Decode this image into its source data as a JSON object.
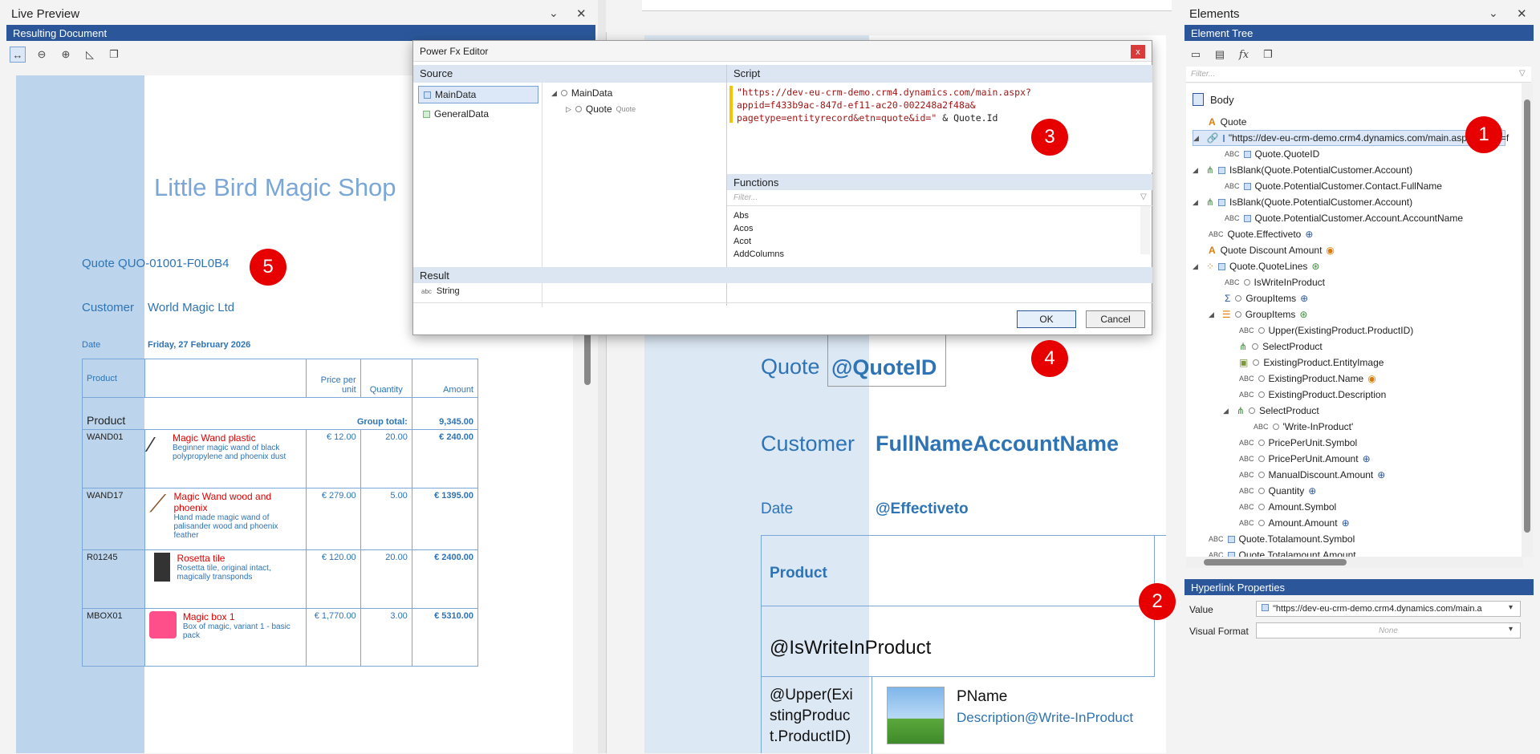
{
  "live_preview": {
    "title": "Live Preview",
    "subtitle": "Resulting Document",
    "doc": {
      "shop_name": "Little Bird Magic Shop",
      "quote_label": "Quote QUO-01001-F0L0B4",
      "customer_label": "Customer",
      "customer_value": "World Magic Ltd",
      "date_label": "Date",
      "date_value": "Friday, 27 February 2026",
      "table": {
        "headers": [
          "Product",
          "Price per unit",
          "Quantity",
          "Amount"
        ],
        "group_label": "Product",
        "group_total_label": "Group total:",
        "group_total_value": "9,345.00",
        "rows": [
          {
            "code": "WAND01",
            "name": "Magic Wand plastic",
            "desc": "Beginner magic wand of black polypropylene and phoenix dust",
            "price": "€ 12.00",
            "qty": "20.00",
            "amount": "€ 240.00"
          },
          {
            "code": "WAND17",
            "name": "Magic Wand wood and phoenix",
            "desc": "Hand made magic wand of palisander wood and phoenix feather",
            "price": "€ 279.00",
            "qty": "5.00",
            "amount": "€ 1395.00"
          },
          {
            "code": "R01245",
            "name": "Rosetta tile",
            "desc": "Rosetta tile, original intact, magically transponds",
            "price": "€ 120.00",
            "qty": "20.00",
            "amount": "€ 2400.00"
          },
          {
            "code": "MBOX01",
            "name": "Magic box 1",
            "desc": "Box of magic, variant 1 - basic pack",
            "price": "€ 1,770.00",
            "qty": "3.00",
            "amount": "€ 5310.00"
          }
        ]
      }
    }
  },
  "designer": {
    "quote_label": "Quote",
    "quote_field": "@QuoteID",
    "customer_label": "Customer",
    "customer_field": "FullNameAccountName",
    "date_label": "Date",
    "date_field": "@Effectiveto",
    "product_header": "Product",
    "writein_field": "@IsWriteInProduct",
    "upper_field": "@Upper(ExistingProduct.ProductID)",
    "pname": "PName",
    "desc_field": "Description@Write-InProduct"
  },
  "dialog": {
    "title": "Power Fx Editor",
    "source_label": "Source",
    "sources": [
      "MainData",
      "GeneralData"
    ],
    "tree_root": "MainData",
    "tree_child": "Quote",
    "tree_child_type": "Quote",
    "script_label": "Script",
    "script_line1": "\"https://dev-eu-crm-demo.crm4.dynamics.com/main.aspx?",
    "script_line2": "appid=f433b9ac-847d-ef11-ac20-002248a2f48a&",
    "script_line3": "pagetype=entityrecord&etn=quote&id=\"",
    "script_op": "&",
    "script_ref": "Quote.Id",
    "functions_label": "Functions",
    "functions_filter": "Filter...",
    "functions": [
      "Abs",
      "Acos",
      "Acot",
      "AddColumns"
    ],
    "result_label": "Result",
    "result_type_icon": "abc",
    "result_value": "String",
    "ok": "OK",
    "cancel": "Cancel",
    "close": "x"
  },
  "elements": {
    "title": "Elements",
    "subtitle": "Element Tree",
    "filter": "Filter...",
    "tree": [
      {
        "label": "Body",
        "level": 0
      },
      {
        "label": "Quote",
        "level": 1
      },
      {
        "label": "\"https://dev-eu-crm-demo.crm4.dynamics.com/main.aspx?appid=f",
        "level": 1
      },
      {
        "label": "Quote.QuoteID",
        "level": 2
      },
      {
        "label": "IsBlank(Quote.PotentialCustomer.Account)",
        "level": 1
      },
      {
        "label": "Quote.PotentialCustomer.Contact.FullName",
        "level": 2
      },
      {
        "label": "IsBlank(Quote.PotentialCustomer.Account)",
        "level": 1
      },
      {
        "label": "Quote.PotentialCustomer.Account.AccountName",
        "level": 2
      },
      {
        "label": "Quote.Effectiveto",
        "level": 1
      },
      {
        "label": "Quote Discount Amount",
        "level": 1
      },
      {
        "label": "Quote.QuoteLines",
        "level": 1
      },
      {
        "label": "IsWriteInProduct",
        "level": 2
      },
      {
        "label": "GroupItems",
        "level": 2
      },
      {
        "label": "GroupItems",
        "level": 2
      },
      {
        "label": "Upper(ExistingProduct.ProductID)",
        "level": 3
      },
      {
        "label": "SelectProduct",
        "level": 3
      },
      {
        "label": "ExistingProduct.EntityImage",
        "level": 3
      },
      {
        "label": "ExistingProduct.Name",
        "level": 3
      },
      {
        "label": "ExistingProduct.Description",
        "level": 3
      },
      {
        "label": "SelectProduct",
        "level": 3
      },
      {
        "label": "'Write-InProduct'",
        "level": 4
      },
      {
        "label": "PricePerUnit.Symbol",
        "level": 3
      },
      {
        "label": "PricePerUnit.Amount",
        "level": 3
      },
      {
        "label": "ManualDiscount.Amount",
        "level": 3
      },
      {
        "label": "Quantity",
        "level": 3
      },
      {
        "label": "Amount.Symbol",
        "level": 3
      },
      {
        "label": "Amount.Amount",
        "level": 3
      },
      {
        "label": "Quote.Totalamount.Symbol",
        "level": 1
      },
      {
        "label": "Quote.Totalamount.Amount",
        "level": 1
      }
    ],
    "props_title": "Hyperlink Properties",
    "value_label": "Value",
    "value_text": "\"https://dev-eu-crm-demo.crm4.dynamics.com/main.a",
    "visual_format_label": "Visual Format",
    "visual_format_value": "None"
  },
  "badges": [
    "1",
    "2",
    "3",
    "4",
    "5"
  ],
  "colors": {
    "accent": "#2b579a",
    "badge": "#e60000",
    "doc_blue": "#2e74b5"
  }
}
